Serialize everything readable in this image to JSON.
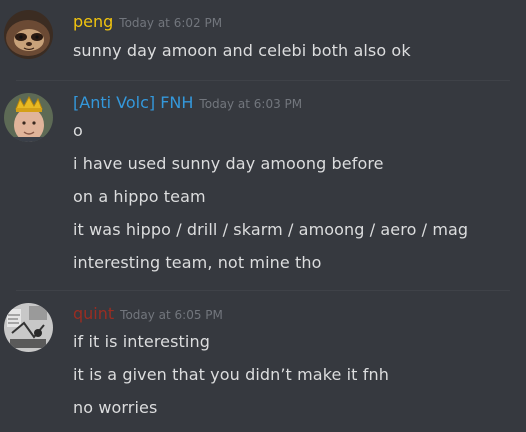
{
  "colors": {
    "background": "#36393f",
    "text": "#dcddde",
    "timestamp": "#72767d",
    "peng": "#f1c40f",
    "fnh": "#3498db",
    "quint": "#992d22"
  },
  "messages": [
    {
      "username": "peng",
      "timestamp": "Today at 6:02 PM",
      "avatar_icon": "sloth-avatar-icon",
      "lines": [
        "sunny day amoon and celebi both also ok"
      ]
    },
    {
      "username": "[Anti Volc] FNH",
      "timestamp": "Today at 6:03 PM",
      "avatar_icon": "crowned-man-avatar-icon",
      "lines": [
        "o",
        "i have used sunny day amoong before",
        "on a hippo team",
        "it was hippo / drill / skarm / amoong / aero / mag",
        "interesting team, not mine tho"
      ]
    },
    {
      "username": "quint",
      "timestamp": "Today at 6:05 PM",
      "avatar_icon": "sketch-avatar-icon",
      "lines": [
        "if it is interesting",
        "it is a given that you didn’t make it fnh",
        "no worries"
      ]
    }
  ]
}
